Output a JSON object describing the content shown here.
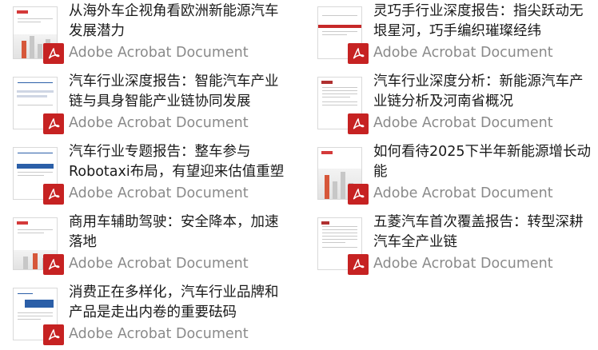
{
  "file_type_label": "Adobe Acrobat Document",
  "files": [
    {
      "title_lines": [
        "从海外车企视角看欧洲新能源汽车",
        "发展潜力"
      ]
    },
    {
      "title_lines": [
        "灵巧手行业深度报告：指尖跃动无",
        "垠星河，巧手编织璀璨经纬"
      ]
    },
    {
      "title_lines": [
        "汽车行业深度报告：智能汽车产业",
        "链与具身智能产业链协同发展"
      ]
    },
    {
      "title_lines": [
        "汽车行业深度分析：新能源汽车产",
        "业链分析及河南省概况"
      ]
    },
    {
      "title_lines": [
        "汽车行业专题报告：整车参与",
        "Robotaxi布局，有望迎来估值重塑"
      ]
    },
    {
      "title_lines": [
        "如何看待2025下半年新能源增长动",
        "能"
      ]
    },
    {
      "title_lines": [
        "商用车辅助驾驶：安全降本，加速",
        "落地"
      ]
    },
    {
      "title_lines": [
        "五菱汽车首次覆盖报告：转型深耕",
        "汽车全产业链"
      ]
    },
    {
      "title_lines": [
        "消费正在多样化，汽车行业品牌和",
        "产品是走出内卷的重要砝码"
      ]
    }
  ],
  "icons": {
    "badge": "pdf-icon"
  },
  "colors": {
    "pdf_red": "#c62222",
    "subtitle_gray": "#8a8a8a"
  }
}
